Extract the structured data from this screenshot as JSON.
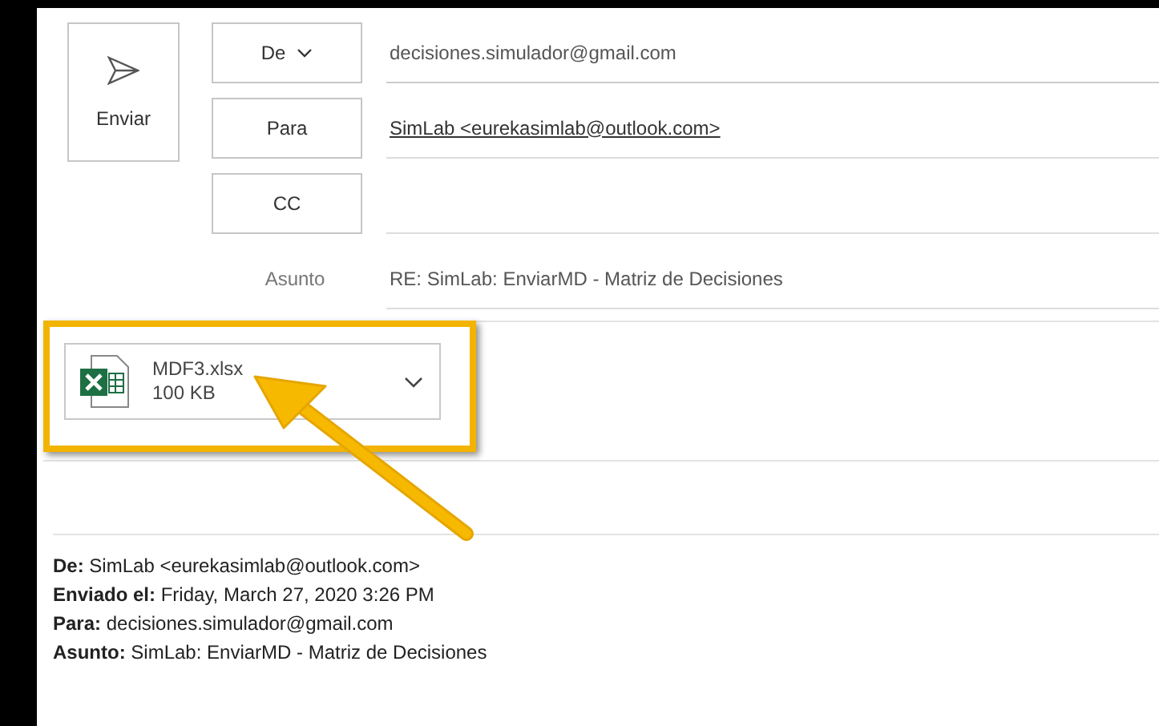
{
  "send_button": {
    "label": "Enviar"
  },
  "fields": [
    {
      "kind": "dropdown",
      "label": "De",
      "value": "decisiones.simulador@gmail.com",
      "link": false
    },
    {
      "kind": "button",
      "label": "Para",
      "value": "SimLab <eurekasimlab@outlook.com>",
      "link": true
    },
    {
      "kind": "button",
      "label": "CC"
    },
    {
      "kind": "text",
      "label": "Asunto",
      "value": "RE: SimLab: EnviarMD - Matriz de Decisiones",
      "link": false
    }
  ],
  "attachment": {
    "name": "MDF3.xlsx",
    "size": "100 KB",
    "highlighted": true
  },
  "quoted_header": [
    "**De:** SimLab <eurekasimlab@outlook.com>",
    "**Enviado el:** Friday, March 27, 2020 3:26 PM",
    "**Para:** decisiones.simulador@gmail.com",
    "**Asunto:** SimLab: EnviarMD - Matriz de Decisiones"
  ]
}
